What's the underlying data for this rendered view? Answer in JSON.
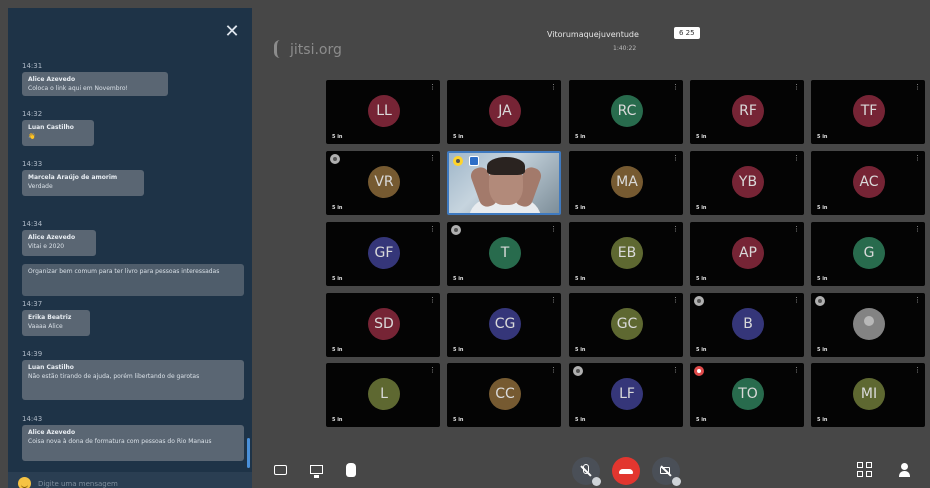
{
  "chat": {
    "messages": [
      {
        "time": "14:31",
        "name": "Alice Azevedo",
        "text": "Coloca o link aqui em Novembro!",
        "own": false
      },
      {
        "time": "14:32",
        "name": "Luan Castilho",
        "text": "👋",
        "own": false
      },
      {
        "time": "14:33",
        "name": "Marcela Araújo de amorim",
        "text": "Verdade",
        "own": false
      },
      {
        "time": "14:34",
        "name": "Alice Azevedo",
        "text": "Vitai e 2020",
        "own": false
      },
      {
        "time": "",
        "name": "",
        "text": "Organizar bem comum para ter livro para pessoas interessadas",
        "own": true
      },
      {
        "time": "14:37",
        "name": "Erika Beatriz",
        "text": "Vaaaa Alice",
        "own": false
      },
      {
        "time": "14:39",
        "name": "Luan Castilho",
        "text": "Não estão tirando de ajuda, porém libertando de garotas",
        "own": false
      },
      {
        "time": "14:43",
        "name": "Alice Azevedo",
        "text": "Coisa nova à dona de formatura com pessoas do Rio Manaus",
        "own": false
      }
    ],
    "input_placeholder": "Digite uma mensagem"
  },
  "header": {
    "logo": "jitsi.org",
    "meeting_title": "Vitorumaquejuventude",
    "participant_count": "6 25",
    "timer": "1:40:22"
  },
  "participants": [
    {
      "initials": "LL",
      "color": "#8a2a3e",
      "name": "5 in",
      "badge": ""
    },
    {
      "initials": "JA",
      "color": "#8a2a3e",
      "name": "5 in",
      "badge": ""
    },
    {
      "initials": "RC",
      "color": "#2f7d5a",
      "name": "5 in",
      "badge": ""
    },
    {
      "initials": "RF",
      "color": "#8a2a3e",
      "name": "5 in",
      "badge": ""
    },
    {
      "initials": "TF",
      "color": "#8a2a3e",
      "name": "5 in",
      "badge": ""
    },
    {
      "initials": "VR",
      "color": "#8a6a3a",
      "name": "5 in",
      "badge": "grey"
    },
    {
      "initials": "",
      "color": "",
      "name": "",
      "badge": "video"
    },
    {
      "initials": "MA",
      "color": "#8a6a3a",
      "name": "5 in",
      "badge": ""
    },
    {
      "initials": "YB",
      "color": "#8a2a3e",
      "name": "5 in",
      "badge": ""
    },
    {
      "initials": "AC",
      "color": "#8a2a3e",
      "name": "5 in",
      "badge": ""
    },
    {
      "initials": "GF",
      "color": "#3e3f8e",
      "name": "5 in",
      "badge": ""
    },
    {
      "initials": "T",
      "color": "#2f7d5a",
      "name": "5 in",
      "badge": "grey"
    },
    {
      "initials": "EB",
      "color": "#6e7a3a",
      "name": "5 in",
      "badge": ""
    },
    {
      "initials": "AP",
      "color": "#8a2a3e",
      "name": "5 in",
      "badge": ""
    },
    {
      "initials": "G",
      "color": "#2f7d5a",
      "name": "5 in",
      "badge": ""
    },
    {
      "initials": "SD",
      "color": "#8a2a3e",
      "name": "5 in",
      "badge": ""
    },
    {
      "initials": "CG",
      "color": "#3e3f8e",
      "name": "5 in",
      "badge": ""
    },
    {
      "initials": "GC",
      "color": "#6e7a3a",
      "name": "5 in",
      "badge": ""
    },
    {
      "initials": "B",
      "color": "#3e3f8e",
      "name": "5 in",
      "badge": "grey"
    },
    {
      "initials": "",
      "color": "#9a9a9a",
      "name": "5 in",
      "badge": "grey"
    },
    {
      "initials": "L",
      "color": "#6e7a3a",
      "name": "5 in",
      "badge": ""
    },
    {
      "initials": "CC",
      "color": "#8a6a3a",
      "name": "5 in",
      "badge": ""
    },
    {
      "initials": "LF",
      "color": "#3e3f8e",
      "name": "5 in",
      "badge": "grey"
    },
    {
      "initials": "TO",
      "color": "#2f7d5a",
      "name": "5 in",
      "badge": "red"
    },
    {
      "initials": "MI",
      "color": "#6e7a3a",
      "name": "5 in",
      "badge": ""
    }
  ],
  "icons": {
    "close": "close-icon",
    "emoji": "emoji-icon",
    "chat": "chat-icon",
    "share": "screen-share-icon",
    "hand": "raise-hand-icon",
    "mic": "microphone-muted-icon",
    "hangup": "hangup-icon",
    "camera": "camera-muted-icon",
    "grid": "tile-view-icon",
    "more": "participants-icon"
  }
}
